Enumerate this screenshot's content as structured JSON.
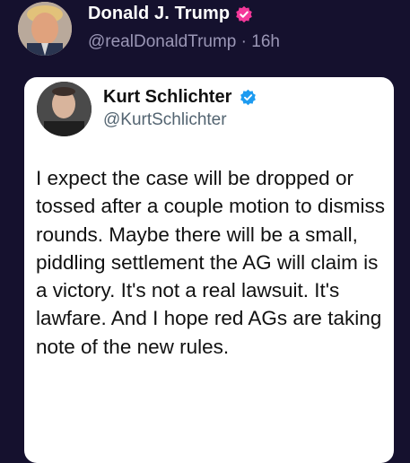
{
  "post": {
    "author_name": "Donald J. Trump",
    "verified_badge_icon": "pink-verified-check-icon",
    "handle_time": "@realDonaldTrump · 16h"
  },
  "quote": {
    "author_name": "Kurt Schlichter",
    "verified_badge_icon": "blue-verified-check-icon",
    "handle": "@KurtSchlichter",
    "body": "I expect the case will be dropped or tossed after a couple motion to dismiss rounds. Maybe there will be a small, piddling settlement the AG will claim is a victory. It's not a real lawsuit. It's lawfare. And I hope red AGs are taking note of the new rules."
  },
  "colors": {
    "background": "#15112e",
    "card": "#ffffff",
    "pink_badge": "#f4389a",
    "blue_badge": "#1d9bf0"
  }
}
